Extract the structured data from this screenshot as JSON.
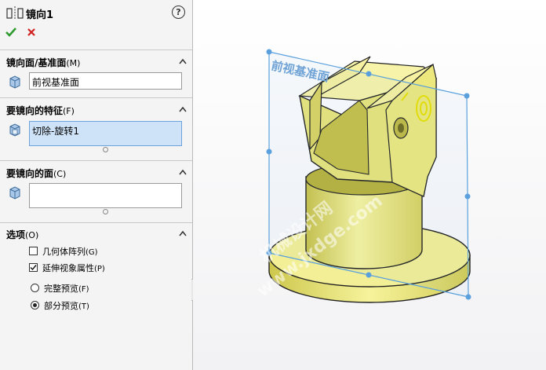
{
  "panel": {
    "title": "镜向1",
    "help_icon": "help-icon",
    "ok_icon": "checkmark-icon",
    "cancel_icon": "close-icon"
  },
  "sections": {
    "mirror_plane": {
      "title": "镜向面/基准面",
      "hotkey": "(M)",
      "value": "前视基准面"
    },
    "features": {
      "title": "要镜向的特征",
      "hotkey": "(F)",
      "value": "切除-旋转1"
    },
    "faces": {
      "title": "要镜向的面",
      "hotkey": "(C)",
      "value": ""
    },
    "options": {
      "title": "选项",
      "hotkey": "(O)",
      "geometry_pattern": {
        "label": "几何体阵列",
        "hotkey": "(G)",
        "checked": false
      },
      "propagate_visual": {
        "label": "延伸视象属性",
        "hotkey": "(P)",
        "checked": true
      },
      "full_preview": {
        "label": "完整预览",
        "hotkey": "(F)",
        "selected": false
      },
      "partial_preview": {
        "label": "部分预览",
        "hotkey": "(T)",
        "selected": true
      }
    }
  },
  "viewport": {
    "plane_label": "前视基准面",
    "watermark_1": "机械设计网",
    "watermark_2": "www.jxdge.com",
    "part_color": "#f0ee8a",
    "plane_color": "#5aa0dc"
  }
}
